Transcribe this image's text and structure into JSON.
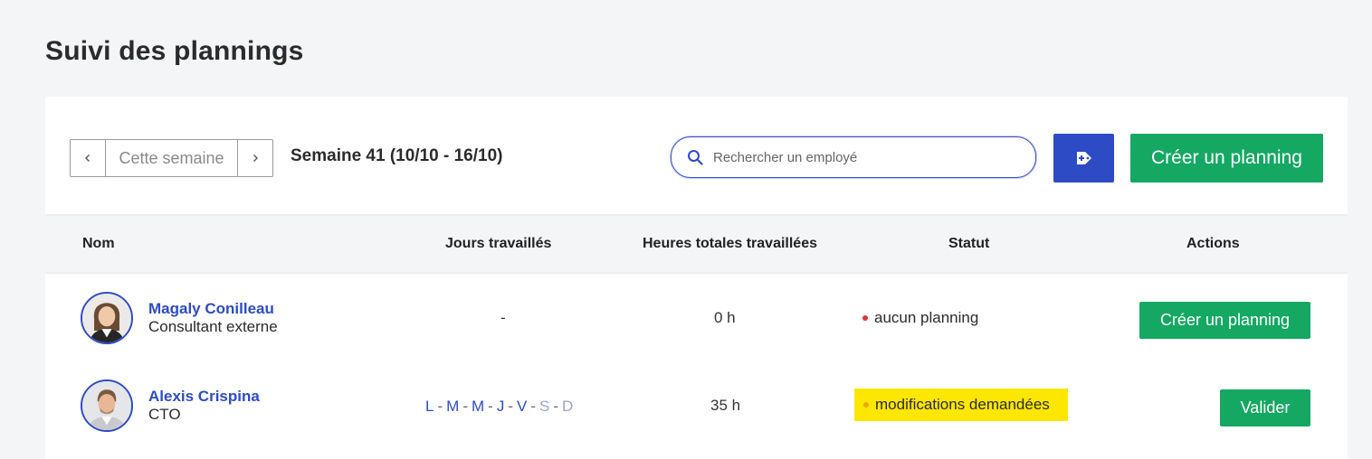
{
  "page": {
    "title": "Suivi des plannings"
  },
  "toolbar": {
    "week_current_label": "Cette semaine",
    "week_label": "Semaine 41 (10/10 - 16/10)",
    "search_placeholder": "Rechercher un employé",
    "create_button_label": "Créer un planning"
  },
  "table": {
    "headers": {
      "name": "Nom",
      "days": "Jours travaillés",
      "hours": "Heures totales travaillées",
      "status": "Statut",
      "actions": "Actions"
    },
    "rows": [
      {
        "name": "Magaly Conilleau",
        "role": "Consultant externe",
        "days_text": "-",
        "hours": "0 h",
        "status": "aucun planning",
        "status_dot_color": "#d9363e",
        "action_label": "Créer un planning"
      },
      {
        "name": "Alexis Crispina",
        "role": "CTO",
        "days": [
          {
            "letter": "L",
            "worked": true
          },
          {
            "letter": "M",
            "worked": true
          },
          {
            "letter": "M",
            "worked": true
          },
          {
            "letter": "J",
            "worked": true
          },
          {
            "letter": "V",
            "worked": true
          },
          {
            "letter": "S",
            "worked": false
          },
          {
            "letter": "D",
            "worked": false
          }
        ],
        "days_separator": "-",
        "hours": "35 h",
        "status": "modifications demandées",
        "status_dot_color": "#f0a500",
        "status_highlight_color": "#fde600",
        "action_label": "Valider"
      }
    ]
  },
  "colors": {
    "accent_blue": "#2e4bc6",
    "primary_green": "#14a862",
    "background": "#f4f5f7"
  },
  "icons": {
    "prev": "chevron-left-icon",
    "next": "chevron-right-icon",
    "search": "search-icon",
    "tag_add": "tag-plus-icon"
  }
}
